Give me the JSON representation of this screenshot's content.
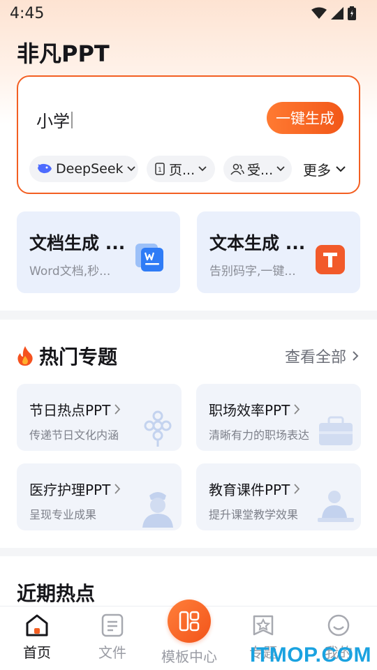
{
  "status_bar": {
    "time": "4:45"
  },
  "app_title": "非凡PPT",
  "input_card": {
    "query": "小学",
    "generate_label": "一键生成",
    "chips": [
      {
        "label": "DeepSeek",
        "icon": "deepseek-whale-icon"
      },
      {
        "label": "页...",
        "icon": "page-count-icon"
      },
      {
        "label": "受...",
        "icon": "audience-icon"
      }
    ],
    "more_label": "更多"
  },
  "features": [
    {
      "title": "文档生成 ...",
      "subtitle": "Word文档,秒...",
      "icon": "word-doc-icon"
    },
    {
      "title": "文本生成 ...",
      "subtitle": "告别码字,一键...",
      "icon": "text-t-icon"
    }
  ],
  "hot_topics": {
    "title": "热门专题",
    "view_all": "查看全部",
    "items": [
      {
        "title": "节日热点PPT",
        "subtitle": "传递节日文化内涵",
        "art": "chinese-knot-icon"
      },
      {
        "title": "职场效率PPT",
        "subtitle": "清晰有力的职场表达",
        "art": "briefcase-icon"
      },
      {
        "title": "医疗护理PPT",
        "subtitle": "呈现专业成果",
        "art": "nurse-icon"
      },
      {
        "title": "教育课件PPT",
        "subtitle": "提升课堂教学效果",
        "art": "teacher-icon"
      }
    ]
  },
  "recent": {
    "title": "近期热点"
  },
  "tabs": [
    {
      "label": "首页",
      "icon": "home-icon",
      "active": true
    },
    {
      "label": "文件",
      "icon": "file-icon",
      "active": false
    },
    {
      "label": "模板中心",
      "icon": "template-icon",
      "active": false
    },
    {
      "label": "专题",
      "icon": "topic-star-icon",
      "active": false
    },
    {
      "label": "我的",
      "icon": "profile-smile-icon",
      "active": false
    }
  ],
  "watermark": "ITMOP.COM",
  "colors": {
    "accent": "#f35f22",
    "feature_bg": "#eaf0fc",
    "topic_bg": "#f1f4fa",
    "watermark": "#1aa2e0"
  }
}
